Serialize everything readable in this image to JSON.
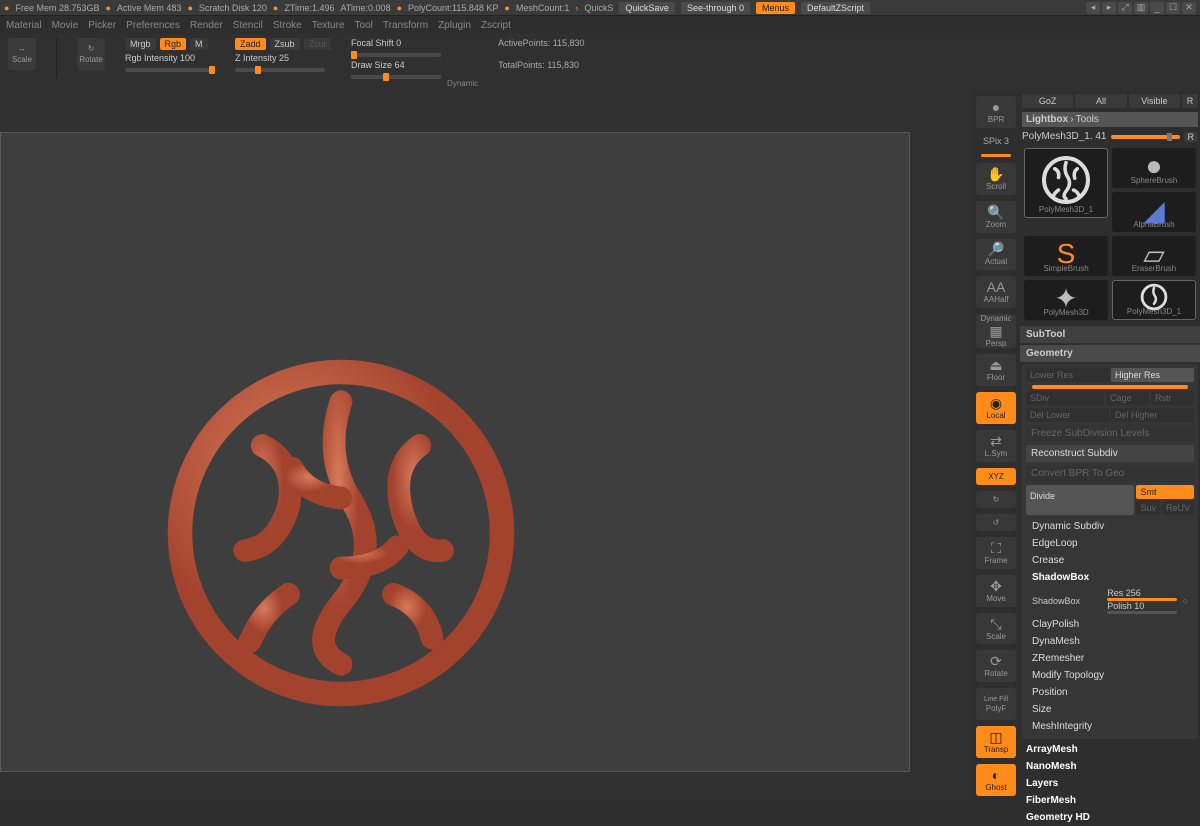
{
  "title": {
    "free_mem": "Free Mem 28.753GB",
    "active_mem": "Active Mem 483",
    "scratch": "Scratch Disk 120",
    "ztime": "ZTime:1.496",
    "atime": "ATime:0.008",
    "polycount": "PolyCount:115.848 KP",
    "meshcount": "MeshCount:1",
    "quicks": "QuickS",
    "quicksave": "QuickSave",
    "seethrough": "See-through  0",
    "menus": "Menus",
    "zscript": "DefaultZScript"
  },
  "menu": [
    "Material",
    "Movie",
    "Picker",
    "Preferences",
    "Render",
    "Stencil",
    "Stroke",
    "Texture",
    "Tool",
    "Transform",
    "Zplugin",
    "Zscript"
  ],
  "toolbar": {
    "scale": "Scale",
    "rotate": "Rotate",
    "mrgb": "Mrgb",
    "rgb": "Rgb",
    "m": "M",
    "rgbint": "Rgb Intensity 100",
    "zadd": "Zadd",
    "zsub": "Zsub",
    "zcut": "Zcut",
    "zint": "Z Intensity 25",
    "focal": "Focal Shift 0",
    "drawsize": "Draw Size 64",
    "dynamic": "Dynamic",
    "activepts": "ActivePoints: 115,830",
    "totalpts": "TotalPoints: 115,830"
  },
  "dock": {
    "bpr": "BPR",
    "spix": "SPix 3",
    "scroll": "Scroll",
    "zoom": "Zoom",
    "actual": "Actual",
    "aahalf": "AAHalf",
    "persp_l1": "Dynamic",
    "persp_l2": "Persp",
    "floor": "Floor",
    "local": "Local",
    "lsym": "L.Sym",
    "xyz": "XYZ",
    "frame": "Frame",
    "move": "Move",
    "scale": "Scale",
    "rotate": "Rotate",
    "linefill": "Line Fill",
    "polyf": "PolyF",
    "transp": "Transp",
    "ghost": "Ghost"
  },
  "right": {
    "tabs": {
      "goz": "GoZ",
      "all": "All",
      "visible": "Visible",
      "r": "R"
    },
    "bread1": "Lightbox",
    "bread2": "Tools",
    "toolname": "PolyMesh3D_1. 41",
    "r": "R",
    "thumbs": [
      "PolyMesh3D_1",
      "SphereBrush",
      "AlphaBrush",
      "SimpleBrush",
      "EraserBrush",
      "PolyMesh3D",
      "PolyMesh3D_1"
    ],
    "subtool": "SubTool",
    "geometry": "Geometry",
    "lowerres": "Lower Res",
    "higherres": "Higher Res",
    "sdiv": "SDiv",
    "cage": "Cage",
    "rstr": "Rstr",
    "dellower": "Del Lower",
    "delhigher": "Del Higher",
    "freeze": "Freeze SubDivision Levels",
    "recon": "Reconstruct Subdiv",
    "convert": "Convert BPR To Geo",
    "divide": "Divide",
    "smt": "Smt",
    "suv": "Suv",
    "reuv": "ReUV",
    "dsubdiv": "Dynamic Subdiv",
    "edgeloop": "EdgeLoop",
    "crease": "Crease",
    "shadowbox": "ShadowBox",
    "shadowbox2": "ShadowBox",
    "res": "Res 256",
    "polish": "Polish 10",
    "claypolish": "ClayPolish",
    "dynamesh": "DynaMesh",
    "zremesh": "ZRemesher",
    "modtopo": "Modify Topology",
    "position": "Position",
    "size": "Size",
    "meshint": "MeshIntegrity",
    "array": "ArrayMesh",
    "nano": "NanoMesh",
    "layers": "Layers",
    "fiber": "FiberMesh",
    "geohd": "Geometry HD"
  }
}
